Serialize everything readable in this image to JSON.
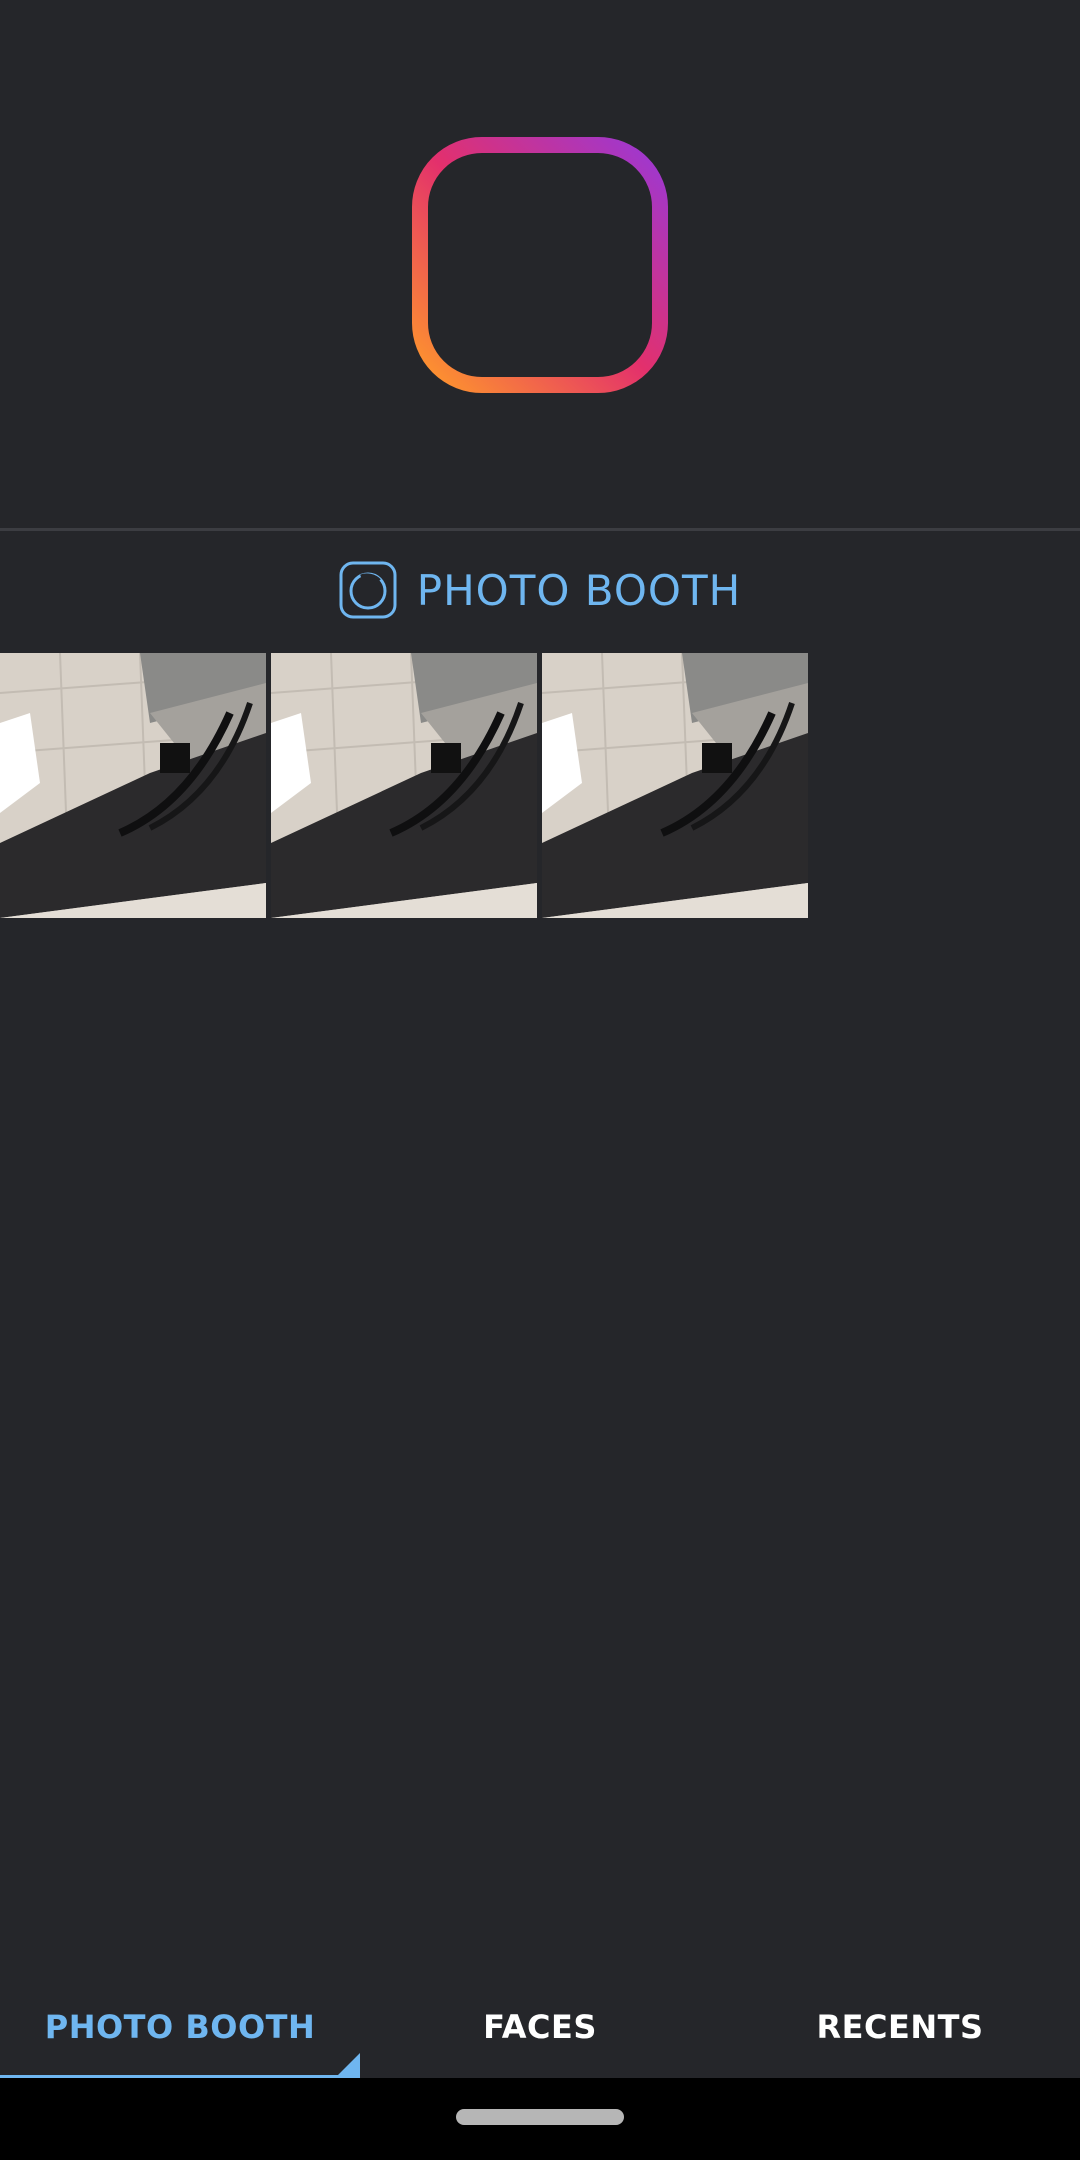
{
  "app": {
    "logo_icon": "layout-grid-logo-icon"
  },
  "section": {
    "icon": "photo-booth-icon",
    "title": "PHOTO BOOTH"
  },
  "thumbnails": [
    {
      "name": "photo-thumbnail-1"
    },
    {
      "name": "photo-thumbnail-2"
    },
    {
      "name": "photo-thumbnail-3"
    }
  ],
  "tabs": [
    {
      "label": "PHOTO BOOTH",
      "active": true
    },
    {
      "label": "FACES",
      "active": false
    },
    {
      "label": "RECENTS",
      "active": false
    }
  ],
  "colors": {
    "background": "#25262a",
    "accent": "#6fb6f0",
    "logo_gradient": [
      "#8e3bd1",
      "#e3306c",
      "#ff9a2a"
    ]
  }
}
